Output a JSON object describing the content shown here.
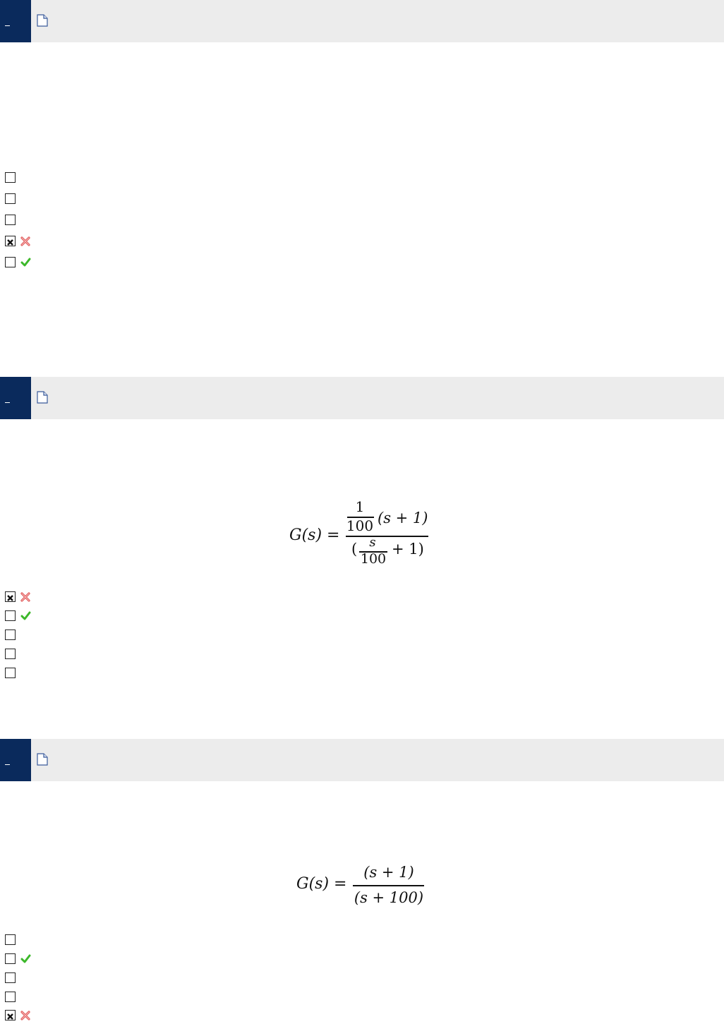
{
  "questions": [
    {
      "header_top": 0,
      "options": [
        {
          "checked": false,
          "result": ""
        },
        {
          "checked": false,
          "result": ""
        },
        {
          "checked": false,
          "result": ""
        },
        {
          "checked": true,
          "result": "wrong"
        },
        {
          "checked": false,
          "result": "correct"
        }
      ]
    },
    {
      "equation": {
        "lhs": "G(s) =",
        "num_frac_top": "1",
        "num_frac_bottom": "100",
        "num_rest": "(s + 1)",
        "den_left": "(",
        "den_frac_top": "s",
        "den_frac_bottom": "100",
        "den_rest": "+ 1)"
      },
      "options": [
        {
          "checked": true,
          "result": "wrong"
        },
        {
          "checked": false,
          "result": "correct"
        },
        {
          "checked": false,
          "result": ""
        },
        {
          "checked": false,
          "result": ""
        },
        {
          "checked": false,
          "result": ""
        }
      ]
    },
    {
      "equation": {
        "lhs": "G(s) =",
        "numerator": "(s + 1)",
        "denominator": "(s + 100)"
      },
      "options": [
        {
          "checked": false,
          "result": ""
        },
        {
          "checked": false,
          "result": "correct"
        },
        {
          "checked": false,
          "result": ""
        },
        {
          "checked": false,
          "result": ""
        },
        {
          "checked": true,
          "result": "wrong"
        }
      ]
    }
  ],
  "colors": {
    "header_bg": "#ececec",
    "number_block": "#0a2a5c",
    "correct": "#3cb82a",
    "wrong": "#e05a5a"
  },
  "icons": {
    "document": "document-icon",
    "correct": "check-icon",
    "wrong": "cross-icon"
  }
}
